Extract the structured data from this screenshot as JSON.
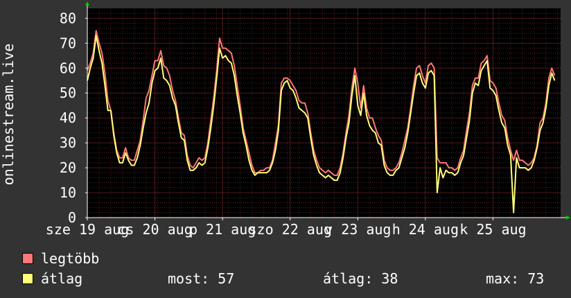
{
  "chart_data": {
    "type": "line",
    "ylabel": "onlinestream.live",
    "ylim": [
      0,
      84
    ],
    "yticks": [
      0,
      10,
      20,
      30,
      40,
      50,
      60,
      70,
      80
    ],
    "xlim": [
      0,
      161
    ],
    "grid": true,
    "xtick_labels": [
      {
        "label": "sze 19 aug",
        "pos": 0
      },
      {
        "label": "cs 20 aug",
        "pos": 23
      },
      {
        "label": "p 21 aug",
        "pos": 46
      },
      {
        "label": "szo 22 aug",
        "pos": 69
      },
      {
        "label": "v 23 aug",
        "pos": 92
      },
      {
        "label": "h 24 aug",
        "pos": 115
      },
      {
        "label": "k 25 aug",
        "pos": 138
      }
    ],
    "series": [
      {
        "name": "legtöbb",
        "color": "#ff7777",
        "values": [
          59,
          62,
          66,
          75,
          70,
          66,
          58,
          47,
          43,
          34,
          27,
          24,
          24,
          28,
          24,
          23,
          23,
          27,
          31,
          39,
          48,
          51,
          57,
          63,
          63,
          67,
          61,
          60,
          57,
          51,
          47,
          40,
          34,
          33,
          25,
          21,
          20,
          22,
          24,
          23,
          24,
          30,
          39,
          48,
          59,
          72,
          68,
          68,
          67,
          66,
          61,
          53,
          45,
          36,
          31,
          26,
          21,
          18,
          18,
          19,
          19,
          20,
          20,
          23,
          30,
          37,
          54,
          56,
          56,
          55,
          53,
          51,
          47,
          46,
          46,
          42,
          34,
          27,
          23,
          20,
          19,
          18,
          19,
          18,
          17,
          17,
          20,
          26,
          34,
          41,
          52,
          60,
          54,
          44,
          53,
          44,
          40,
          40,
          36,
          33,
          31,
          23,
          20,
          19,
          19,
          20,
          22,
          26,
          31,
          36,
          44,
          53,
          60,
          61,
          57,
          54,
          61,
          62,
          60,
          24,
          22,
          22,
          22,
          20,
          20,
          19,
          20,
          24,
          27,
          35,
          42,
          53,
          56,
          56,
          62,
          63,
          65,
          55,
          54,
          52,
          46,
          41,
          39,
          32,
          27,
          23,
          27,
          23,
          23,
          22,
          21,
          22,
          24,
          29,
          38,
          40,
          46,
          56,
          60,
          57
        ]
      },
      {
        "name": "átlag",
        "color": "#ffff77",
        "values": [
          55,
          60,
          64,
          73,
          67,
          62,
          53,
          43,
          43,
          33,
          26,
          22,
          22,
          26,
          23,
          21,
          21,
          24,
          29,
          36,
          42,
          46,
          54,
          59,
          60,
          64,
          56,
          55,
          53,
          48,
          45,
          38,
          32,
          31,
          23,
          19,
          19,
          20,
          22,
          21,
          22,
          28,
          36,
          45,
          56,
          68,
          64,
          65,
          63,
          62,
          57,
          49,
          42,
          34,
          29,
          23,
          19,
          17,
          18,
          18,
          18,
          18,
          19,
          22,
          27,
          35,
          51,
          54,
          55,
          52,
          51,
          48,
          44,
          43,
          42,
          40,
          32,
          25,
          21,
          18,
          17,
          16,
          17,
          16,
          15,
          15,
          18,
          24,
          32,
          38,
          49,
          57,
          45,
          41,
          50,
          41,
          37,
          35,
          34,
          30,
          29,
          21,
          18,
          17,
          17,
          19,
          20,
          24,
          28,
          34,
          42,
          50,
          57,
          58,
          54,
          52,
          58,
          59,
          57,
          10,
          20,
          16,
          19,
          18,
          18,
          17,
          18,
          22,
          25,
          32,
          39,
          50,
          54,
          53,
          59,
          61,
          63,
          52,
          51,
          49,
          43,
          38,
          36,
          29,
          25,
          2,
          24,
          20,
          20,
          20,
          19,
          20,
          23,
          28,
          35,
          38,
          44,
          53,
          58,
          55
        ]
      }
    ]
  },
  "legend": [
    {
      "label": "legtöbb",
      "color": "#ff7777"
    },
    {
      "label": "átlag",
      "color": "#ffff77"
    }
  ],
  "stats": {
    "most_label": "most:",
    "most_value": "57",
    "atlag_label": "átlag:",
    "atlag_value": "38",
    "max_label": "max:",
    "max_value": "73"
  }
}
